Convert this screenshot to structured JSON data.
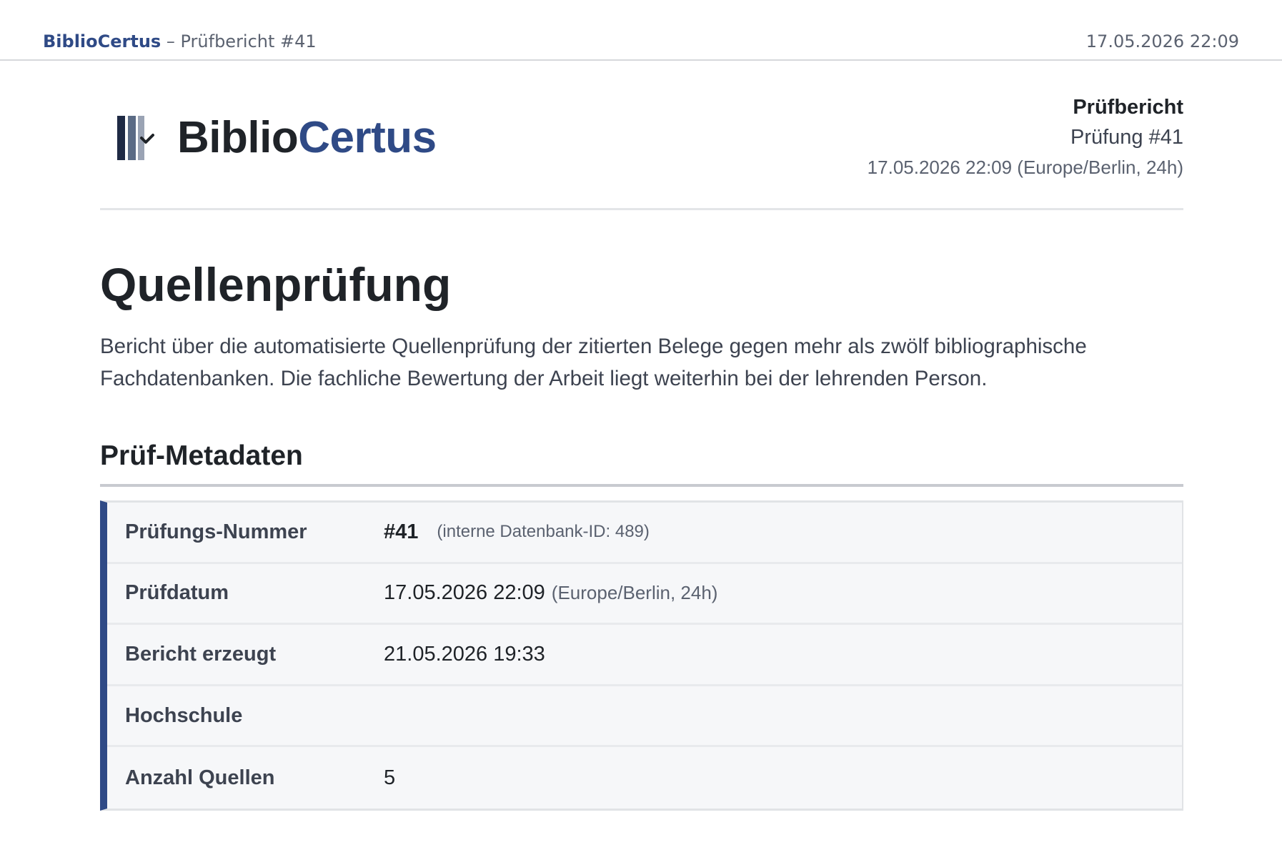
{
  "running_header": {
    "brand": "BiblioCertus",
    "separator": " – ",
    "title": "Prüfbericht #41",
    "datetime": "17.05.2026 22:09"
  },
  "logo": {
    "icon": "books-check-icon",
    "part1": "Biblio",
    "part2": "Certus",
    "colors": {
      "dark": "#1f2328",
      "brand": "#2f4a86",
      "mid": "#5b6b85",
      "light": "#9aa3b4"
    }
  },
  "report_meta": {
    "title": "Prüfbericht",
    "number": "Prüfung #41",
    "datetime": "17.05.2026 22:09 (Europe/Berlin, 24h)"
  },
  "page": {
    "title": "Quellenprüfung",
    "intro": "Bericht über die automatisierte Quellenprüfung der zitierten Belege gegen mehr als zwölf bibliographische Fachdatenbanken. Die fachliche Bewertung der Arbeit liegt weiterhin bei der lehrenden Person."
  },
  "section": {
    "title": "Prüf-Metadaten",
    "accent_color": "#2f4a86",
    "rows": [
      {
        "label": "Prüfungs-Nummer",
        "value": "#41",
        "hint": "(interne Datenbank-ID: 489)"
      },
      {
        "label": "Prüfdatum",
        "value": "17.05.2026 22:09",
        "hint": "(Europe/Berlin, 24h)"
      },
      {
        "label": "Bericht erzeugt",
        "value": "21.05.2026 19:33"
      },
      {
        "label": "Hochschule",
        "value": ""
      },
      {
        "label": "Anzahl Quellen",
        "value": "5"
      }
    ]
  }
}
